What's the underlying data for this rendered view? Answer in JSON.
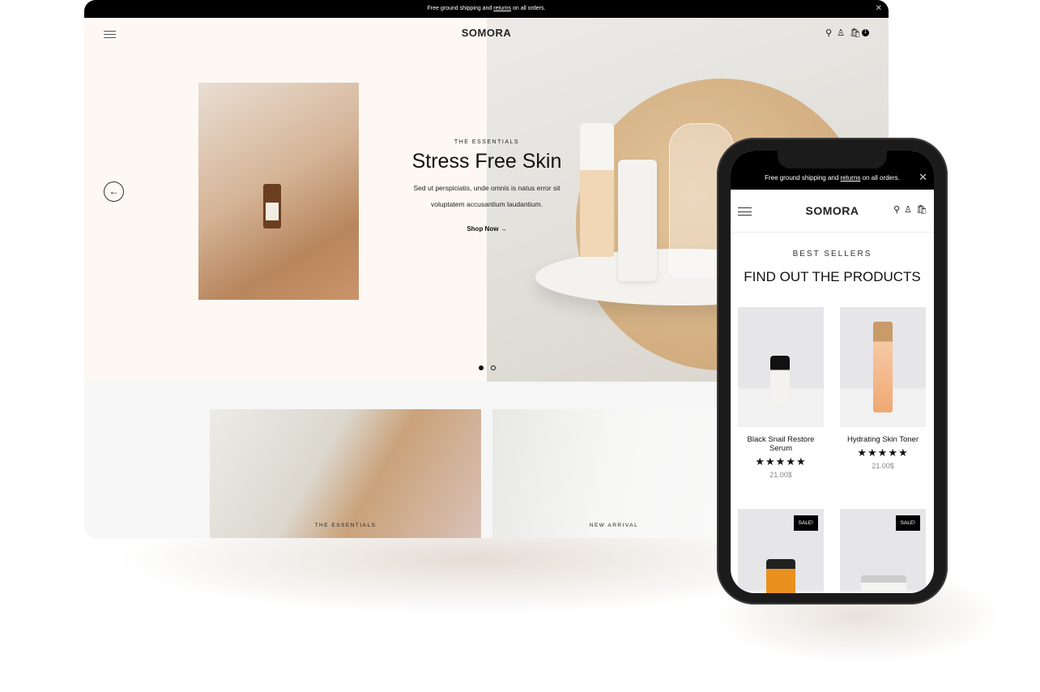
{
  "desktop": {
    "announcement": {
      "before": "Free ground shipping and ",
      "link": "returns",
      "after": " on all orders."
    },
    "logo": "SOMORA",
    "cart_count": "1",
    "hero": {
      "eyebrow": "THE ESSENTIALS",
      "title": "Stress Free Skin",
      "body": "Sed ut perspiciatis, unde omnis is natus error sit voluptatem accusantium laudantium.",
      "cta": "Shop Now →",
      "slides": 2,
      "active_slide": 1
    },
    "collections": [
      {
        "label": "THE ESSENTIALS"
      },
      {
        "label": "NEW ARRIVAL"
      }
    ]
  },
  "mobile": {
    "announcement": {
      "before": "Free ground shipping and ",
      "link": "returns",
      "after": " on all orders."
    },
    "logo": "SOMORA",
    "eyebrow": "BEST SELLERS",
    "heading": "FIND OUT THE PRODUCTS",
    "products": [
      {
        "name": "Black Snail Restore Serum",
        "rating": 5,
        "stars": "★★★★★",
        "price": "21.00$"
      },
      {
        "name": "Hydrating Skin Toner",
        "rating": 5,
        "stars": "★★★★★",
        "price": "21.00$"
      },
      {
        "badge": "SALE!"
      },
      {
        "badge": "SALE!"
      }
    ]
  }
}
